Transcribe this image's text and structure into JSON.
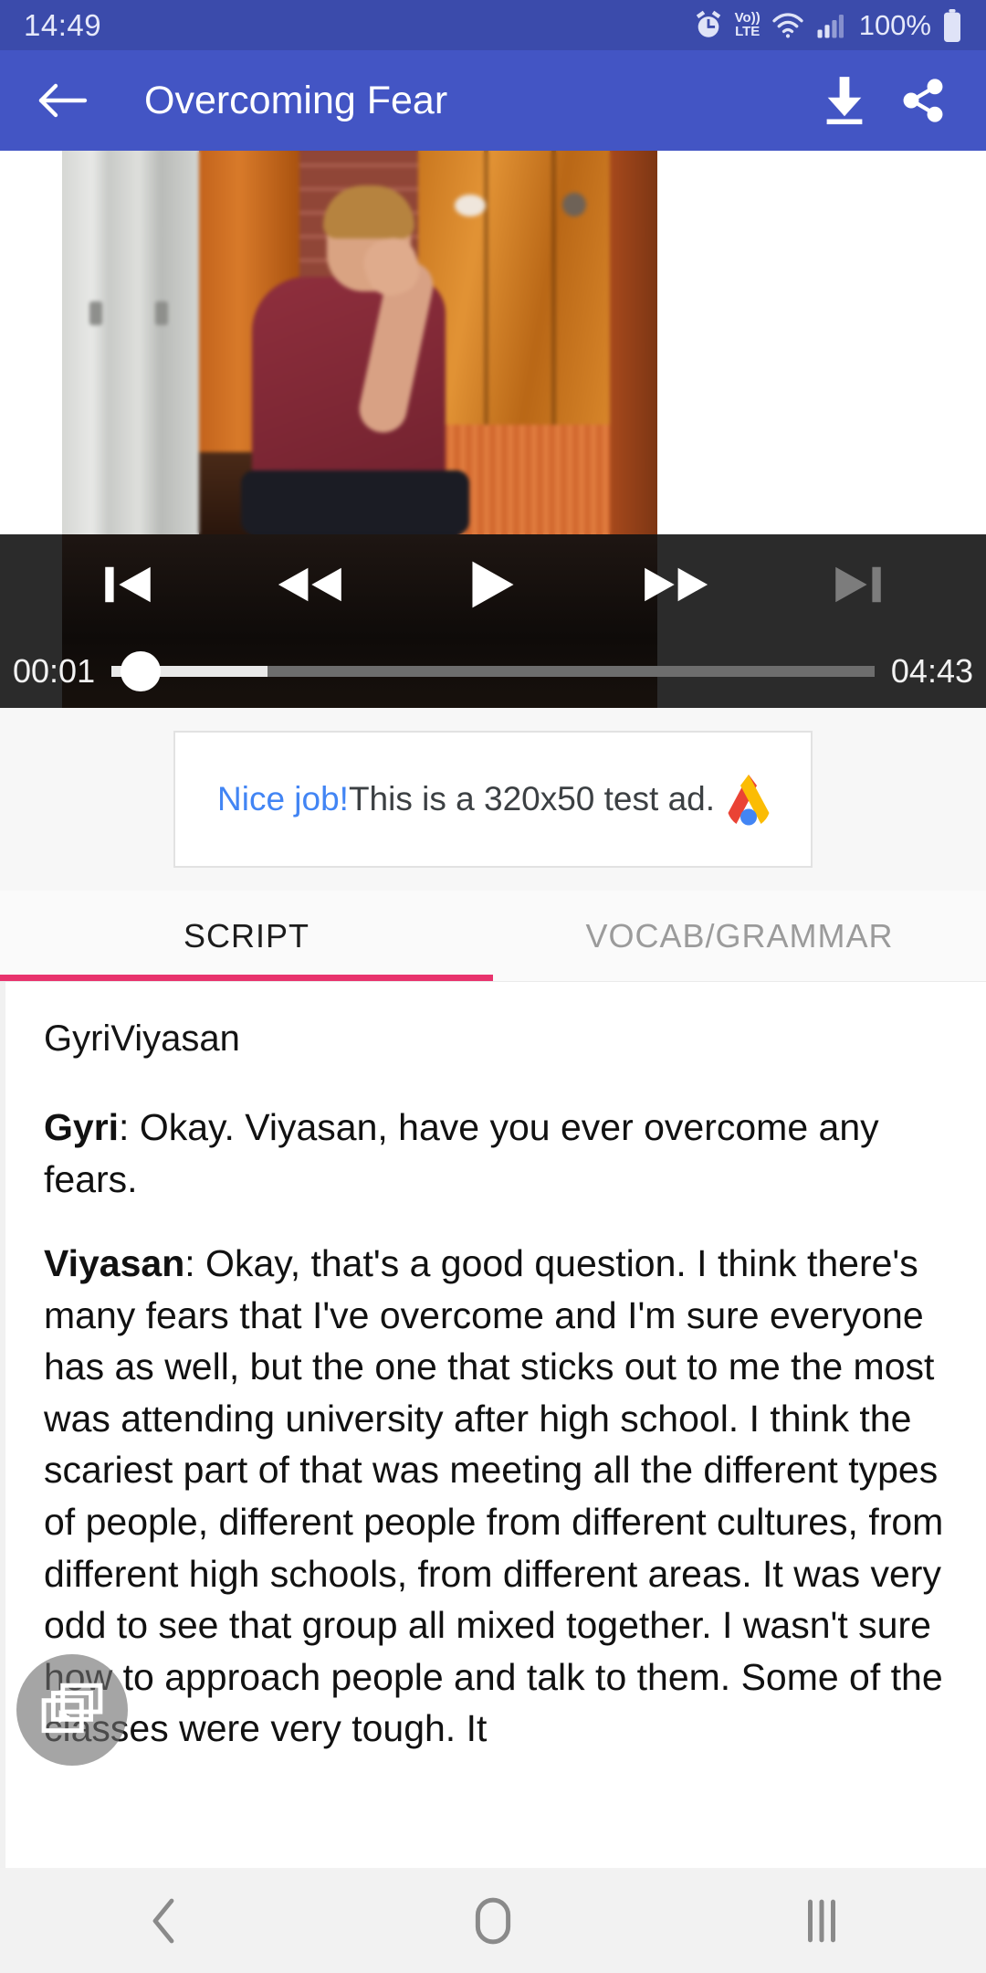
{
  "status_bar": {
    "time": "14:49",
    "battery_percent": "100%",
    "volte_top": "Vo))",
    "volte_bottom": "LTE",
    "icons": [
      "alarm-icon",
      "volte-icon",
      "wifi-icon",
      "signal-icon",
      "battery-icon"
    ]
  },
  "app_bar": {
    "title": "Overcoming Fear",
    "back_icon": "arrow-left-icon",
    "download_icon": "download-icon",
    "share_icon": "share-icon",
    "background_color": "#4355c4"
  },
  "player": {
    "current_time": "00:01",
    "total_time": "04:43",
    "progress_percent": 3,
    "controls": [
      {
        "name": "skip-previous",
        "icon": "skip-previous-icon",
        "enabled": true
      },
      {
        "name": "rewind",
        "icon": "rewind-icon",
        "enabled": true
      },
      {
        "name": "play",
        "icon": "play-icon",
        "enabled": true
      },
      {
        "name": "fast-forward",
        "icon": "fast-forward-icon",
        "enabled": true
      },
      {
        "name": "skip-next",
        "icon": "skip-next-icon",
        "enabled": false
      }
    ]
  },
  "ad": {
    "cta_label": "Nice job!",
    "body_text": "This is a 320x50 test ad.",
    "logo": "admob-icon",
    "cta_color": "#4285f4"
  },
  "tabs": {
    "active_index": 0,
    "indicator_color": "#e8336d",
    "items": [
      {
        "label": "SCRIPT",
        "active": true
      },
      {
        "label": "VOCAB/GRAMMAR",
        "active": false
      }
    ]
  },
  "script": {
    "header": "GyriViyasan",
    "paragraphs": [
      {
        "speaker": "Gyri",
        "text": ": Okay. Viyasan, have you ever overcome any fears."
      },
      {
        "speaker": "Viyasan",
        "text": ": Okay, that's a good question. I think there's many fears that I've overcome and I'm sure everyone has as well, but the one that sticks out to me the most was attending university after high school. I think the scariest part of that was meeting all the different types of people, different people from different cultures, from different high schools, from different areas. It was very odd to see that group all mixed together. I wasn't sure how to approach people and talk to them. Some of the classes were very tough. It"
      }
    ],
    "fab_icon": "video-playlist-icon"
  },
  "nav_bar": {
    "back_icon": "nav-back-icon",
    "home_icon": "nav-home-icon",
    "recents_icon": "nav-recents-icon"
  }
}
